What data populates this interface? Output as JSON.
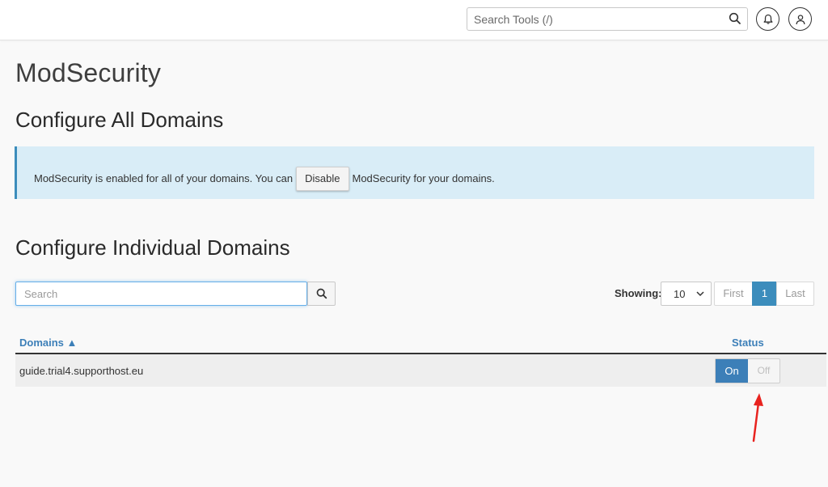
{
  "header": {
    "tool_search_placeholder": "Search Tools (/)",
    "icons": [
      "search-icon",
      "bell-icon",
      "user-icon"
    ]
  },
  "page": {
    "title": "ModSecurity"
  },
  "all_domains": {
    "heading": "Configure All Domains",
    "notice_before": "ModSecurity is enabled for all of your domains. You can",
    "disable_button": "Disable",
    "notice_after": "ModSecurity for your domains."
  },
  "individual_domains": {
    "heading": "Configure Individual Domains",
    "search_placeholder": "Search",
    "showing_label": "Showing:",
    "page_size": "10",
    "pagination": {
      "first": "First",
      "current": "1",
      "last": "Last"
    },
    "table": {
      "columns": {
        "domains": "Domains ▲",
        "status": "Status"
      },
      "rows": [
        {
          "domain": "guide.trial4.supporthost.eu",
          "on_label": "On",
          "off_label": "Off",
          "status": "On"
        }
      ]
    }
  },
  "colors": {
    "accent": "#3c7fb8",
    "alert_bg": "#d9edf7",
    "annotation_arrow": "#e8231f"
  }
}
